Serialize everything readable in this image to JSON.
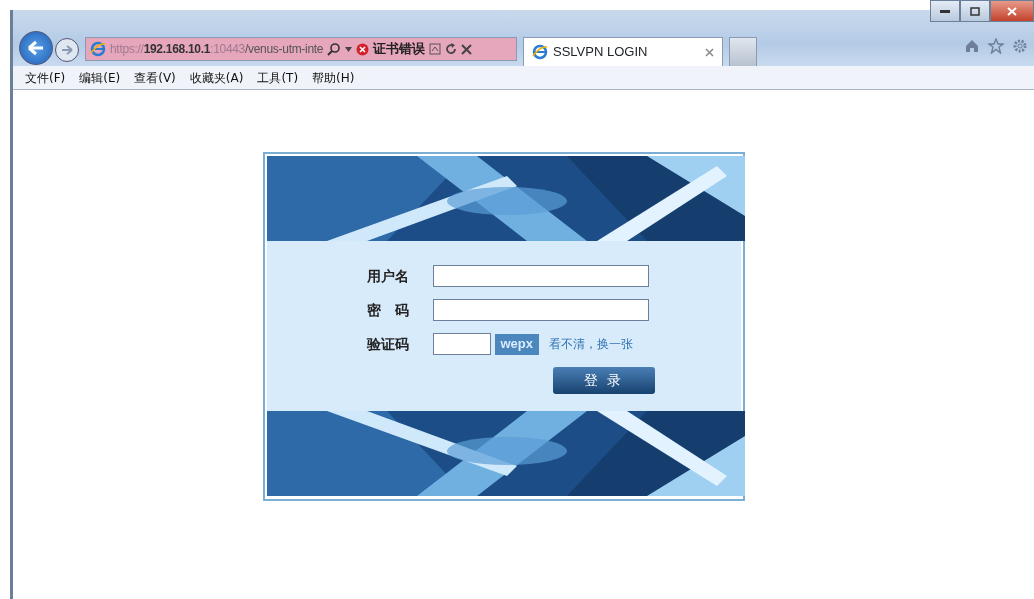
{
  "browser": {
    "address": {
      "prefix": "https://",
      "host": "192.168.10.1",
      "port": ":10443",
      "path": "/venus-utm-inte"
    },
    "certificate_error": "证书错误",
    "tabs": [
      {
        "title": "SSLVPN LOGIN",
        "selected": true
      }
    ],
    "menu": [
      "文件(F)",
      "编辑(E)",
      "查看(V)",
      "收藏夹(A)",
      "工具(T)",
      "帮助(H)"
    ]
  },
  "login": {
    "fields": [
      {
        "label": "用户名",
        "kind": "text"
      },
      {
        "label": "密　码",
        "kind": "password"
      },
      {
        "label": "验证码",
        "kind": "captcha",
        "captcha": "wepx",
        "refresh_link": "看不清，换一张"
      }
    ],
    "submit": "登 录"
  }
}
